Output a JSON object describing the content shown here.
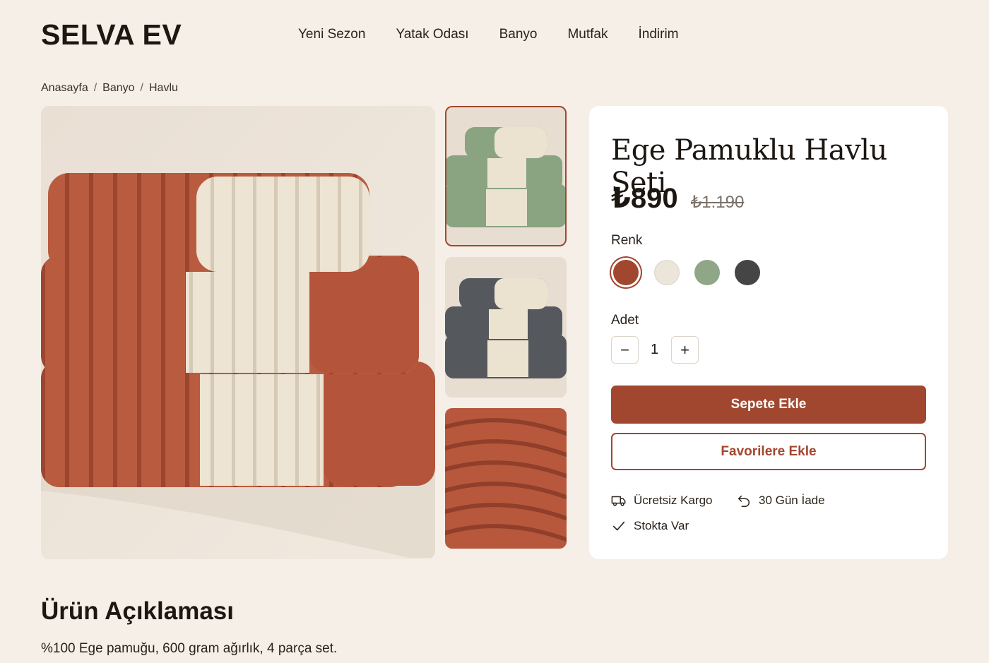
{
  "header": {
    "logo": "SELVA EV",
    "nav": [
      "Yeni Sezon",
      "Yatak Odası",
      "Banyo",
      "Mutfak",
      "İndirim"
    ]
  },
  "breadcrumb": [
    "Anasayfa",
    "Banyo",
    "Havlu"
  ],
  "product": {
    "title": "Ege Pamuklu Havlu Seti",
    "price": "₺890",
    "old_price": "₺1.190",
    "color_label": "Renk",
    "colors": [
      "#a2472f",
      "#ece5da",
      "#8fa787",
      "#454545"
    ],
    "quantity_label": "Adet",
    "quantity": "1",
    "add_to_cart": "Sepete Ekle",
    "add_to_favorites": "Favorilere Ekle",
    "features": [
      "Ücretsiz Kargo",
      "30 Gün İade",
      "Stokta Var"
    ]
  },
  "gallery": {
    "main": "terracotta-towel-stack",
    "thumbs": [
      "green-towel-stack",
      "charcoal-towel-stack",
      "terracotta-texture-closeup"
    ]
  },
  "description": {
    "title": "Ürün Açıklaması",
    "text": "%100 Ege pamuğu, 600 gram ağırlık, 4 parça set."
  }
}
